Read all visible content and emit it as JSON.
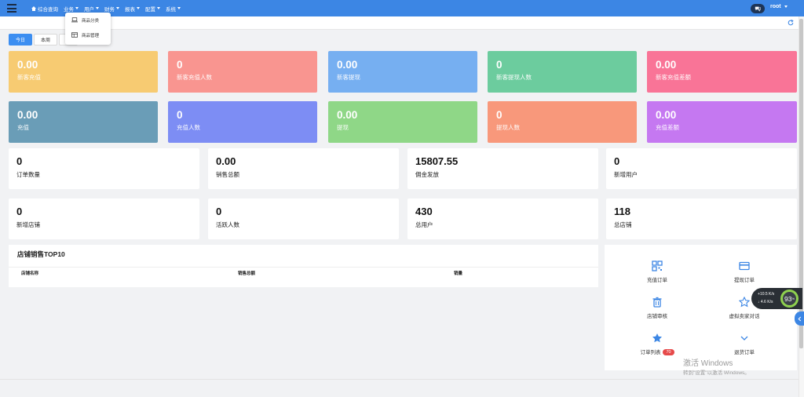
{
  "nav": {
    "items": [
      {
        "label": "综合查询",
        "icon": "home-icon",
        "caret": false
      },
      {
        "label": "业务",
        "caret": true
      },
      {
        "label": "用户",
        "caret": true
      },
      {
        "label": "财务",
        "caret": true
      },
      {
        "label": "报表",
        "caret": true
      },
      {
        "label": "配置",
        "caret": true
      },
      {
        "label": "系统",
        "caret": true
      }
    ],
    "user": "root"
  },
  "dropdown": {
    "items": [
      {
        "label": "商品分类",
        "icon": "laptop-icon"
      },
      {
        "label": "商品管理",
        "icon": "table-icon"
      }
    ]
  },
  "tabs": [
    "今日",
    "本周",
    ""
  ],
  "color_cards": [
    {
      "value": "0.00",
      "label": "新客充值",
      "color": "#f7cb72"
    },
    {
      "value": "0",
      "label": "新客充值人数",
      "color": "#f99590"
    },
    {
      "value": "0.00",
      "label": "新客提现",
      "color": "#76aff1"
    },
    {
      "value": "0",
      "label": "新客提现人数",
      "color": "#6ccc9e"
    },
    {
      "value": "0.00",
      "label": "新客充值差额",
      "color": "#f97497"
    },
    {
      "value": "0.00",
      "label": "充值",
      "color": "#6a9db7"
    },
    {
      "value": "0",
      "label": "充值人数",
      "color": "#7d8df4"
    },
    {
      "value": "0.00",
      "label": "提现",
      "color": "#8fd787"
    },
    {
      "value": "0",
      "label": "提现人数",
      "color": "#f8987b"
    },
    {
      "value": "0.00",
      "label": "充值差额",
      "color": "#c578f1"
    }
  ],
  "stat_cards": [
    {
      "value": "0",
      "label": "订单数量"
    },
    {
      "value": "0.00",
      "label": "销售总额"
    },
    {
      "value": "15807.55",
      "label": "佣金发放"
    },
    {
      "value": "0",
      "label": "新增用户"
    },
    {
      "value": "0",
      "label": "新增店铺"
    },
    {
      "value": "0",
      "label": "活跃人数"
    },
    {
      "value": "430",
      "label": "总用户"
    },
    {
      "value": "118",
      "label": "总店铺"
    }
  ],
  "top10": {
    "title": "店铺销售TOP10",
    "columns": [
      "店铺名称",
      "销售总额",
      "销量"
    ]
  },
  "quick_actions": [
    {
      "label": "充值订单",
      "icon": "qrcode-icon"
    },
    {
      "label": "提现订单",
      "icon": "credit-card-icon"
    },
    {
      "label": "店铺审核",
      "icon": "trash-icon"
    },
    {
      "label": "虚拟卖家对话",
      "icon": "star-outline-icon"
    },
    {
      "label": "订单列表",
      "icon": "star-icon",
      "badge": "70"
    },
    {
      "label": "退货订单",
      "icon": "chevron-down-icon"
    }
  ],
  "net_widget": {
    "up": "+10.5",
    "up_unit": "K/s",
    "down": "4.6",
    "down_unit": "K/s",
    "percent": "93",
    "percent_unit": "%"
  },
  "watermark": {
    "line1": "激活 Windows",
    "line2": "转到\"设置\"以激活 Windows。"
  }
}
